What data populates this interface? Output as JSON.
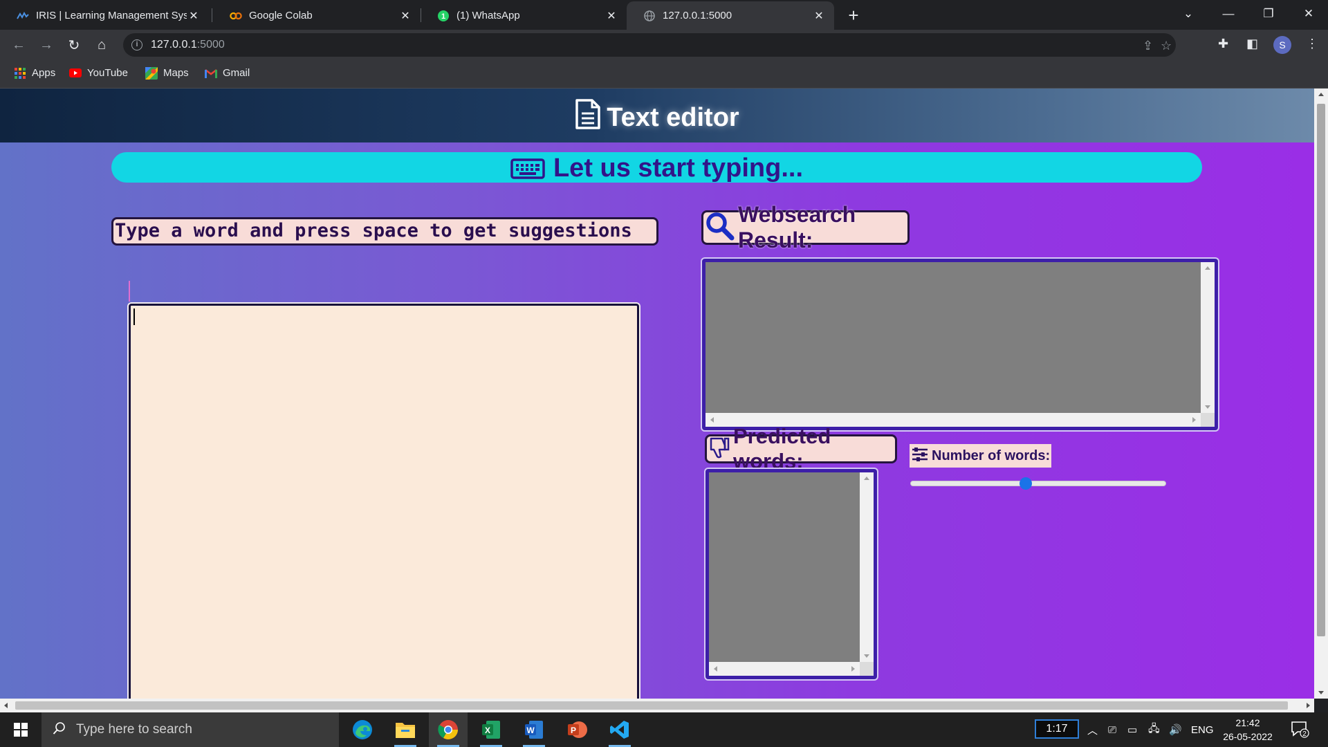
{
  "browser": {
    "tabs": [
      {
        "title": "IRIS | Learning Management Syst",
        "active": false
      },
      {
        "title": "Google Colab",
        "active": false
      },
      {
        "title": "(1) WhatsApp",
        "active": false
      },
      {
        "title": "127.0.0.1:5000",
        "active": true
      }
    ],
    "url_host": "127.0.0.1",
    "url_port": ":5000",
    "profile_initial": "S",
    "bookmarks": [
      "Apps",
      "YouTube",
      "Maps",
      "Gmail"
    ]
  },
  "page": {
    "title": "Text editor",
    "banner": "Let us start typing...",
    "instruction": "Type a word and press space to get suggestions",
    "websearch_label": "Websearch Result:",
    "predicted_label": "Predicted words:",
    "number_of_words_label": "Number of words:",
    "slider_fraction": 0.45
  },
  "taskbar": {
    "search_placeholder": "Type here to search",
    "time_badge": "1:17",
    "language": "ENG",
    "time": "21:42",
    "date": "26-05-2022",
    "notifications": "2",
    "apps": [
      "edge-icon",
      "file-explorer-icon",
      "chrome-icon",
      "excel-icon",
      "word-icon",
      "powerpoint-icon",
      "vscode-icon"
    ]
  },
  "colors": {
    "header_dark": "#0f2440",
    "banner": "#12d6e4",
    "banner_text": "#321489",
    "label_bg": "#f8dcd8",
    "editor_bg": "#fbeada",
    "result_bg": "#7f7f7f",
    "slider_thumb": "#1a73e8"
  }
}
